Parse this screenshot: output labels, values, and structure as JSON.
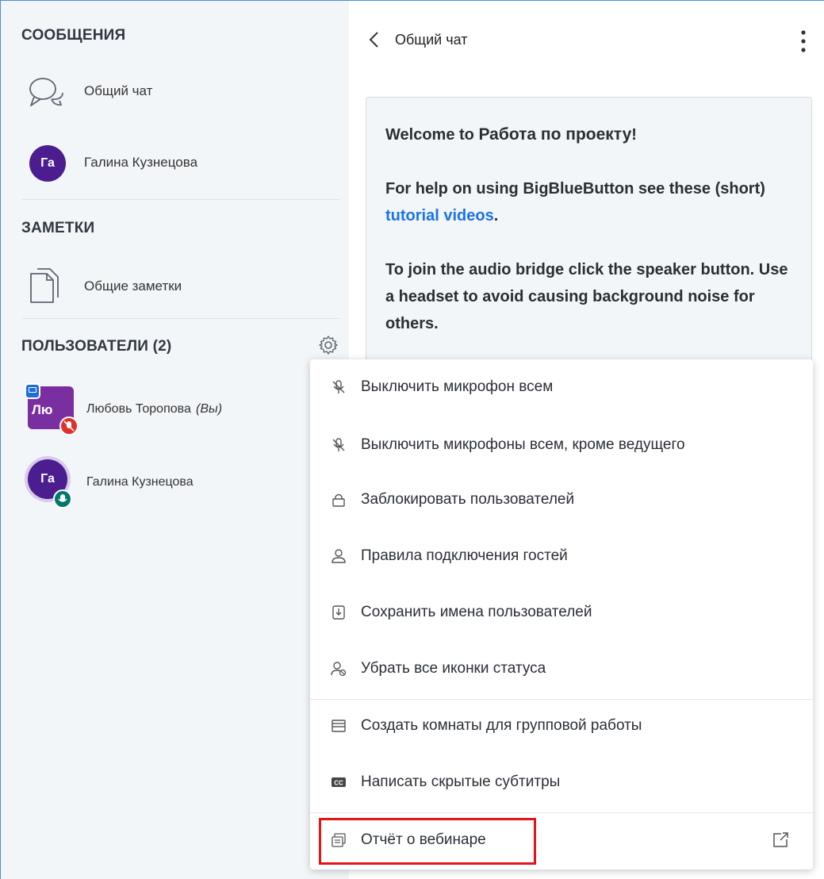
{
  "sidebar": {
    "messages_title": "СООБЩЕНИЯ",
    "public_chat_label": "Общий чат",
    "private_chat": {
      "initials": "Га",
      "name": "Галина Кузнецова"
    },
    "notes_title": "ЗАМЕТКИ",
    "shared_notes_label": "Общие заметки",
    "users_title": "ПОЛЬЗОВАТЕЛИ (2)",
    "users": [
      {
        "initials": "Лю",
        "name": "Любовь Торопова",
        "you_suffix": "(Вы)"
      },
      {
        "initials": "Га",
        "name": "Галина Кузнецова"
      }
    ]
  },
  "chat": {
    "title": "Общий чат",
    "welcome_prefix": "Welcome to ",
    "meeting_name": "Работа по проекту",
    "welcome_suffix": "!",
    "help_prefix": "For help on using BigBlueButton see these (short) ",
    "help_link": "tutorial videos",
    "help_suffix": ".",
    "audio_text": "To join the audio bridge click the speaker button. Use a headset to avoid causing background noise for others."
  },
  "menu": {
    "items": [
      {
        "label": "Выключить микрофон всем",
        "icon": "mic-off-icon"
      },
      {
        "label": "Выключить микрофоны всем, кроме ведущего",
        "icon": "mic-off-icon"
      },
      {
        "label": "Заблокировать пользователей",
        "icon": "lock-icon"
      },
      {
        "label": "Правила подключения гостей",
        "icon": "user-icon"
      },
      {
        "label": "Сохранить имена пользователей",
        "icon": "download-icon"
      },
      {
        "label": "Убрать все иконки статуса",
        "icon": "clear-status-icon"
      },
      {
        "label": "Создать комнаты для групповой работы",
        "icon": "rooms-icon"
      },
      {
        "label": "Написать скрытые субтитры",
        "icon": "closed-caption-icon"
      },
      {
        "label": "Отчёт о вебинаре",
        "icon": "report-icon"
      }
    ]
  },
  "colors": {
    "avatar_purple": "#4b1d8f",
    "presenter_purple": "#7a2fa0",
    "muted_red": "#e0322d",
    "talk_green": "#00796b",
    "link_blue": "#1a73e8",
    "highlight_red": "#e5131a"
  }
}
